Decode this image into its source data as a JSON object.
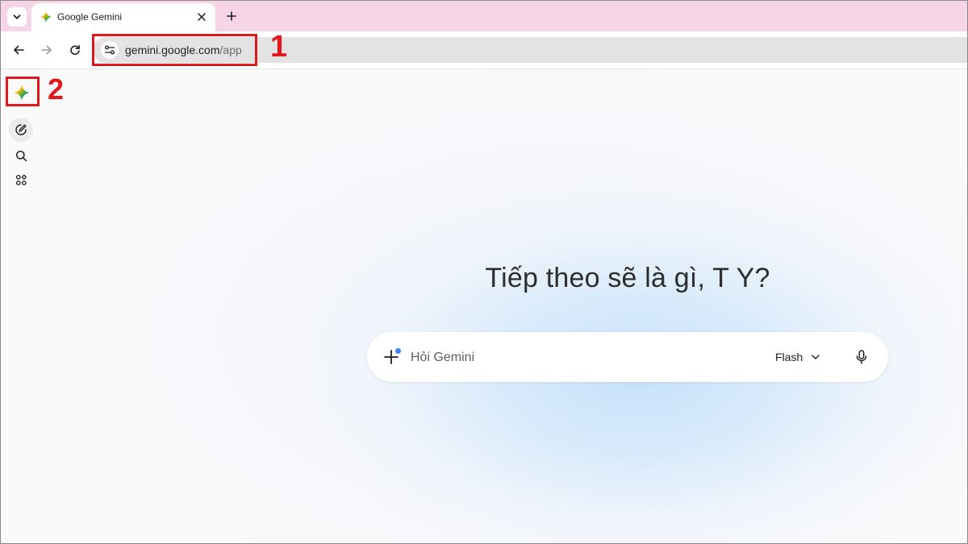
{
  "browser": {
    "tab": {
      "title": "Google Gemini",
      "favicon": "gemini-sparkle-icon"
    },
    "address_bar": {
      "host": "gemini.google.com",
      "path": "/app"
    }
  },
  "annotations": {
    "marker_1": "1",
    "marker_2": "2",
    "color": "#e0191f"
  },
  "sidebar": {
    "items": [
      {
        "icon": "new-chat-icon"
      },
      {
        "icon": "search-icon"
      },
      {
        "icon": "explore-apps-icon"
      }
    ]
  },
  "main": {
    "greeting": "Tiếp theo sẽ là gì, T Y?",
    "prompt": {
      "placeholder": "Hỏi Gemini",
      "model": "Flash"
    }
  },
  "colors": {
    "tab_strip": "#f6d6e6",
    "omnibox": "#e3e3e3",
    "accent_blue": "#3b82f6"
  }
}
